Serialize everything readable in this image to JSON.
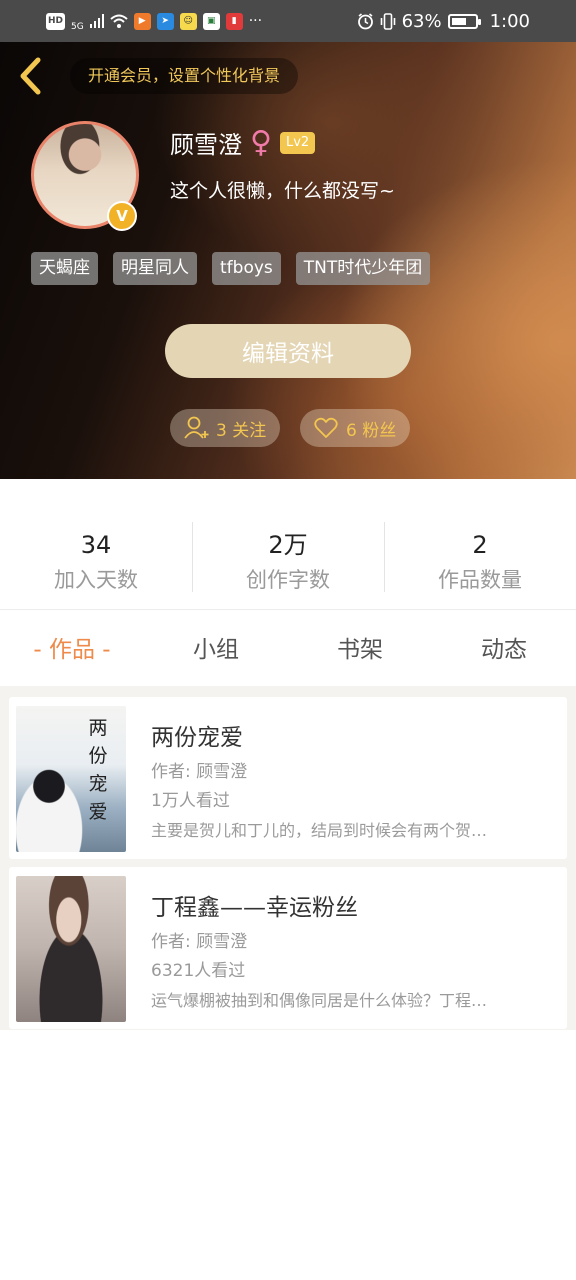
{
  "status_bar": {
    "hd": "HD",
    "network": "5G",
    "battery_percent": "63%",
    "battery_level": 0.63,
    "time": "1:00",
    "more": "···"
  },
  "header": {
    "vip_prompt": "开通会员，设置个性化背景",
    "username": "顾雪澄",
    "gender_symbol": "♀",
    "level": "Lv2",
    "verified_mark": "V",
    "bio": "这个人很懒，什么都没写~",
    "tags": [
      "天蝎座",
      "明星同人",
      "tfboys",
      "TNT时代少年团"
    ],
    "edit_button": "编辑资料",
    "following": "3 关注",
    "followers": "6 粉丝"
  },
  "stats": [
    {
      "value": "34",
      "label": "加入天数"
    },
    {
      "value": "2万",
      "label": "创作字数"
    },
    {
      "value": "2",
      "label": "作品数量"
    }
  ],
  "tabs": [
    "- 作品 -",
    "小组",
    "书架",
    "动态"
  ],
  "works": [
    {
      "title": "两份宠爱",
      "author": "作者: 顾雪澄",
      "views": "1万人看过",
      "desc": "主要是贺儿和丁儿的，结局到时候会有两个贺…",
      "cover_text": "两份宠爱"
    },
    {
      "title": "丁程鑫——幸运粉丝",
      "author": "作者: 顾雪澄",
      "views": "6321人看过",
      "desc": "运气爆棚被抽到和偶像同居是什么体验？丁程…"
    }
  ],
  "colors": {
    "accent_orange": "#ee8a4a",
    "gold": "#f3c64f",
    "edit_button_bg": "#e4d5b4"
  }
}
